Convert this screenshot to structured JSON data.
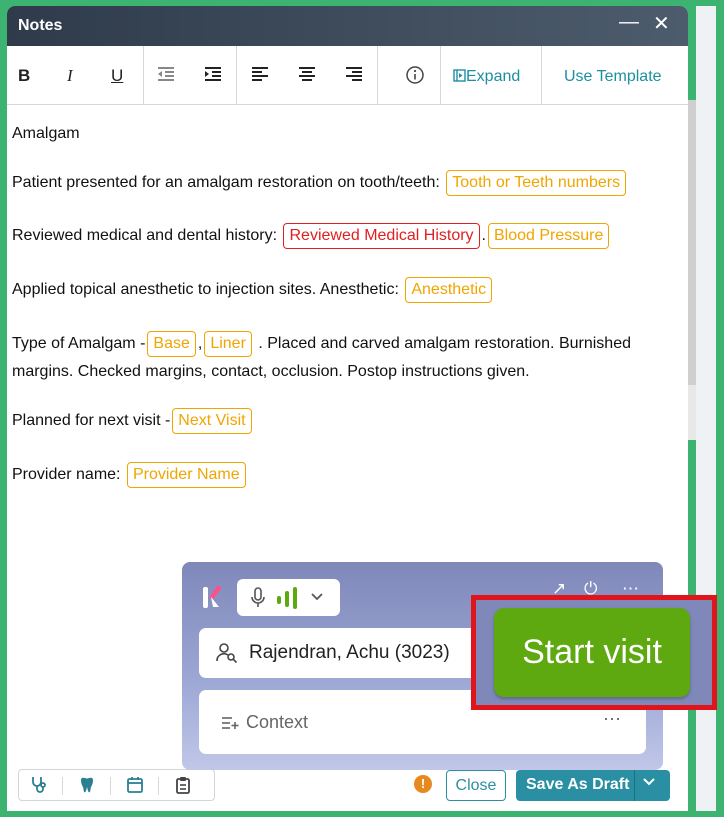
{
  "window": {
    "title": "Notes"
  },
  "toolbar": {
    "expand_label": "Expand",
    "template_label": "Use Template"
  },
  "note": {
    "heading": "Amalgam",
    "l1": {
      "text": "Patient presented for an amalgam restoration on tooth/teeth:",
      "chip": "Tooth or Teeth numbers"
    },
    "l2": {
      "text": "Reviewed medical and dental history:",
      "chip1": "Reviewed Medical History",
      "chip2": "Blood Pressure"
    },
    "l3": {
      "text": "Applied topical anesthetic to injection sites. Anesthetic:",
      "chip": "Anesthetic"
    },
    "l4": {
      "text_a": "Type of Amalgam -",
      "chip1": "Base",
      "chip2": "Liner",
      "text_b": ". Placed and carved amalgam restoration. Burnished",
      "text_c": "margins. Checked margins, contact, occlusion. Postop instructions given."
    },
    "l5": {
      "text": "Planned for next visit -",
      "chip": "Next Visit"
    },
    "l6": {
      "text": "Provider name:",
      "chip": "Provider Name"
    }
  },
  "widget": {
    "patient": "Rajendran, Achu (3023)",
    "context": "Context",
    "start_label": "Start visit"
  },
  "footer": {
    "close_label": "Close",
    "draft_label": "Save As Draft"
  },
  "colors": {
    "accent": "#2a8fa3",
    "chip": "#f0a500",
    "chip_red": "#e02020",
    "start": "#5ea810",
    "highlight": "#e0141b"
  }
}
